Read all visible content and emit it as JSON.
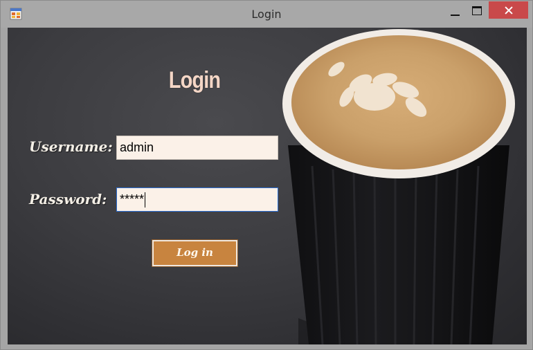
{
  "window": {
    "title": "Login",
    "icon": "app-form-icon",
    "controls": [
      "minimize-icon",
      "maximize-icon",
      "close-icon"
    ]
  },
  "form": {
    "heading": "Login",
    "username_label": "Username:",
    "username_value": "admin",
    "password_label": "Password:",
    "password_value": "*****",
    "submit_label": "Log in"
  },
  "colors": {
    "accent": "#c8843f",
    "close_button": "#c9494a",
    "input_background": "#fbf1e8",
    "heading": "#f4d6c6"
  }
}
